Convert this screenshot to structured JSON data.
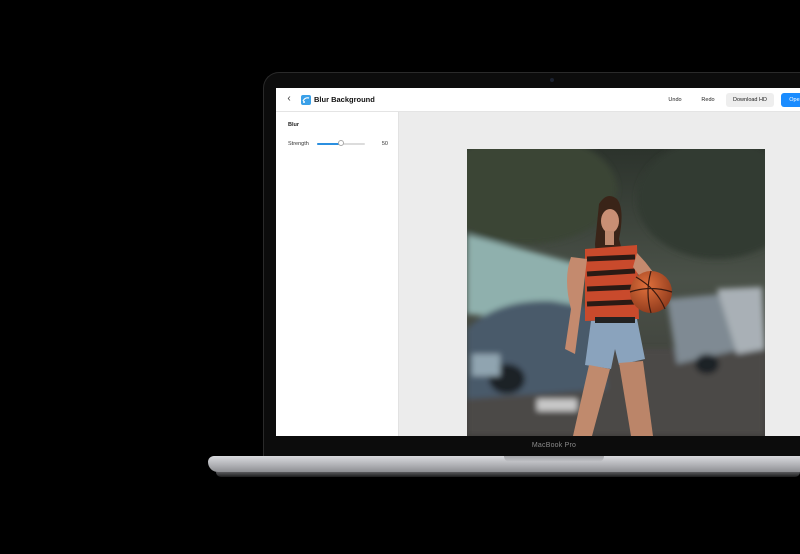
{
  "app": {
    "title": "Blur Background",
    "icon": "blur-icon",
    "accent": "#1a8cff"
  },
  "toolbar": {
    "back_icon": "chevron-left-icon",
    "undo_label": "Undo",
    "redo_label": "Redo",
    "download_label": "Download HD",
    "open_label": "Open"
  },
  "sidebar": {
    "section_title": "Blur",
    "strength": {
      "label": "Strength",
      "value": "50",
      "fraction": 0.5
    }
  },
  "device": {
    "label": "MacBook Pro"
  },
  "canvas": {
    "image": "photo-woman-with-basketball"
  }
}
